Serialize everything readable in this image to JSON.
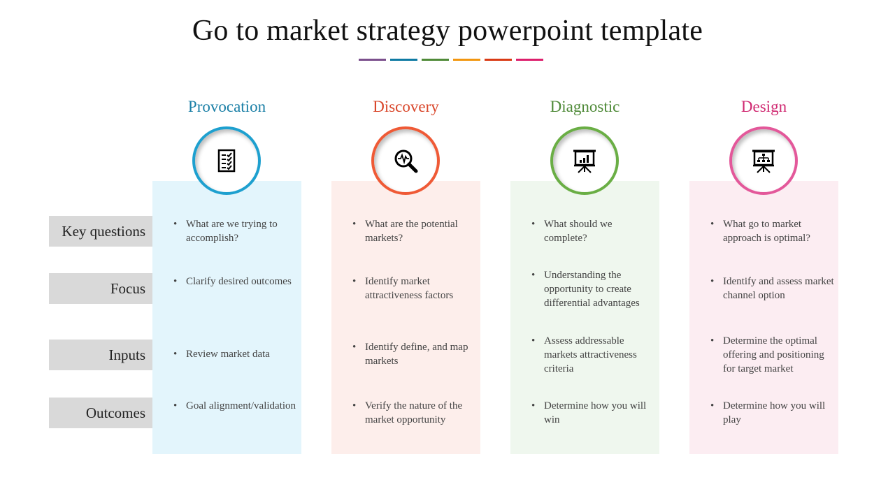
{
  "title": "Go to market strategy powerpoint template",
  "underline_colors": [
    "#7b4f8c",
    "#0e7aa3",
    "#4f8a38",
    "#f2960f",
    "#d93a15",
    "#dc1f6c"
  ],
  "row_labels": [
    "Key questions",
    "Focus",
    "Inputs",
    "Outcomes"
  ],
  "columns": [
    {
      "heading": "Provocation",
      "color": "#1a7fa6",
      "ring_color": "#1ea0cf",
      "panel_color": "#e3f5fc",
      "icon": "checklist-icon",
      "items": [
        "What are we trying to accomplish?",
        "Clarify desired outcomes",
        "Review market data",
        "Goal alignment/validation"
      ]
    },
    {
      "heading": "Discovery",
      "color": "#d9472b",
      "ring_color": "#ef5a36",
      "panel_color": "#fdeeeb",
      "icon": "magnifier-pulse-icon",
      "items": [
        "What are the potential markets?",
        "Identify market attractiveness factors",
        "Identify define, and map markets",
        "Verify the nature of the market opportunity"
      ]
    },
    {
      "heading": "Diagnostic",
      "color": "#4f8a38",
      "ring_color": "#6aae45",
      "panel_color": "#eff7ee",
      "icon": "presentation-chart-icon",
      "items": [
        "What should we complete?",
        "Understanding the opportunity to create differential advantages",
        "Assess addressable markets attractiveness criteria",
        "Determine how you will win"
      ]
    },
    {
      "heading": "Design",
      "color": "#d02a72",
      "ring_color": "#e3589a",
      "panel_color": "#fcedf2",
      "icon": "presentation-hierarchy-icon",
      "items": [
        "What go to market approach is optimal?",
        "Identify and assess market channel option",
        "Determine the optimal offering and positioning for target market",
        "Determine how you will play"
      ]
    }
  ]
}
